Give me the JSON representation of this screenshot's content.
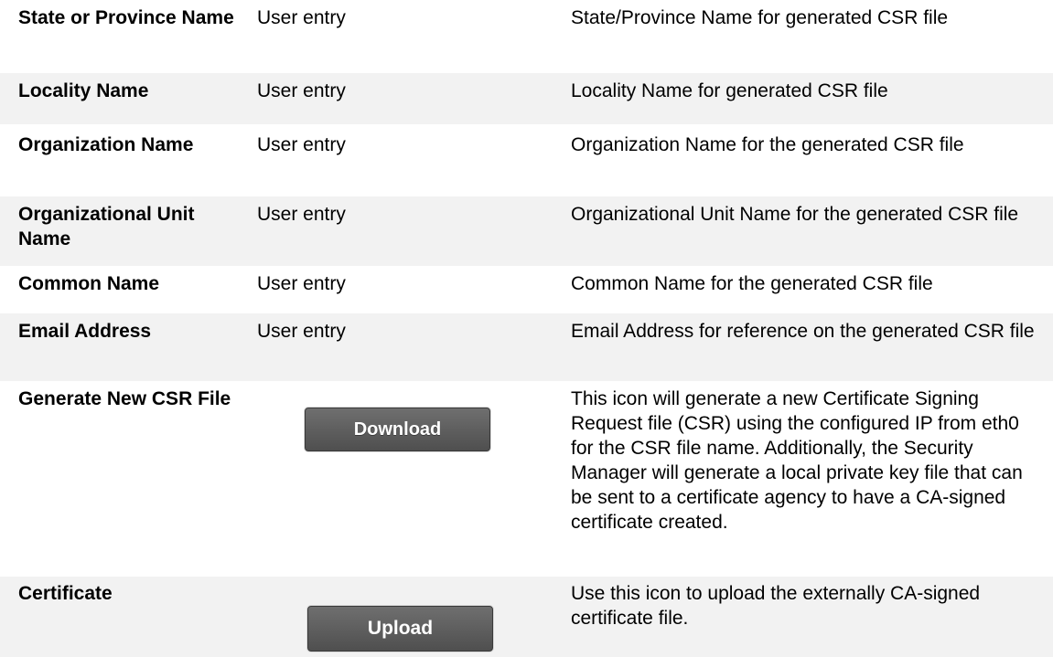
{
  "rows": [
    {
      "field": "State or Province Name",
      "setting": "User entry",
      "description": "State/Province Name for generated CSR file"
    },
    {
      "field": "Locality Name",
      "setting": "User entry",
      "description": "Locality Name for generated CSR file"
    },
    {
      "field": "Organization Name",
      "setting": "User entry",
      "description": "Organization Name for the generated CSR file"
    },
    {
      "field": "Organizational Unit Name",
      "setting": "User entry",
      "description": "Organizational Unit Name for the generated CSR file"
    },
    {
      "field": "Common Name",
      "setting": "User entry",
      "description": "Common Name for the generated CSR file"
    },
    {
      "field": "Email Address",
      "setting": "User entry",
      "description": "Email Address for reference on the generated CSR file"
    },
    {
      "field": "Generate New CSR File",
      "button_label": "Download",
      "description": "This icon will generate a new Certificate Signing Request file (CSR) using the configured IP from eth0 for the CSR file name.  Additionally, the Security Manager will generate a local private key file that can be sent to a certificate agency to have a CA-signed certificate created."
    },
    {
      "field": "Certificate",
      "button_label": "Upload",
      "description": "Use this icon to upload the externally CA-signed certificate file."
    }
  ],
  "colors": {
    "shaded_row": "#f2f2f2",
    "button_bg": "#5f5f5f",
    "button_text": "#ffffff"
  }
}
